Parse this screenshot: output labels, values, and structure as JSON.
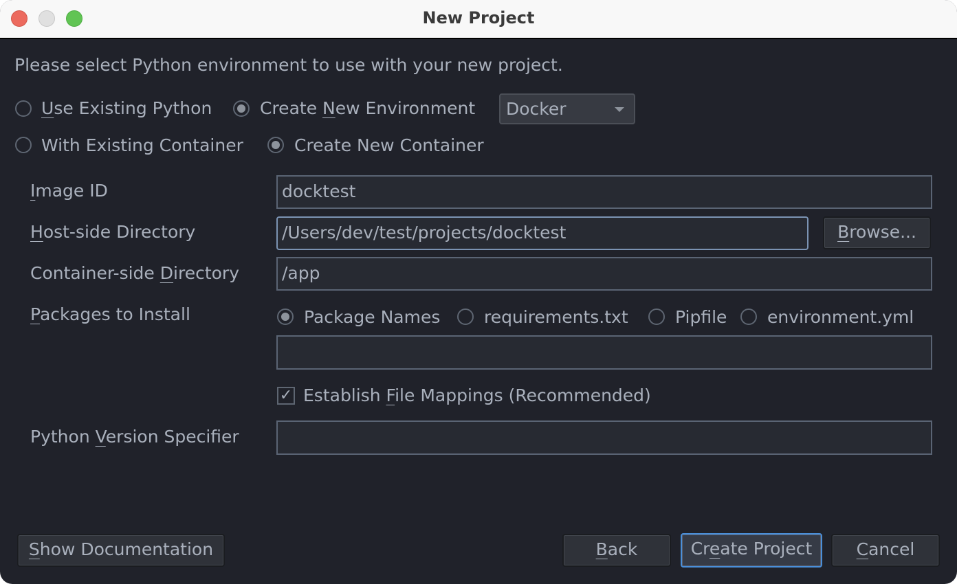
{
  "window": {
    "title": "New Project"
  },
  "intro": "Please select Python environment to use with your new project.",
  "env_options": [
    {
      "label_pre": "",
      "label_u": "U",
      "label_post": "se Existing Python",
      "selected": false
    },
    {
      "label_pre": "Create ",
      "label_u": "N",
      "label_post": "ew Environment",
      "selected": true
    }
  ],
  "env_type": {
    "selected": "Docker"
  },
  "container_options": [
    {
      "label": "With Existing Container",
      "selected": false
    },
    {
      "label": "Create New Container",
      "selected": true
    }
  ],
  "form": {
    "image_id": {
      "label_u": "I",
      "label_rest": "mage ID",
      "value": "docktest"
    },
    "host_dir": {
      "label_u": "H",
      "label_rest": "ost-side Directory",
      "value": "/Users/dev/test/projects/docktest",
      "browse": {
        "u": "B",
        "rest": "rowse..."
      }
    },
    "container_dir": {
      "label_pre": "Container-side ",
      "label_u": "D",
      "label_rest": "irectory",
      "value": "/app"
    },
    "packages": {
      "label_u": "P",
      "label_rest": "ackages to Install",
      "options": [
        {
          "label": "Package Names",
          "selected": true
        },
        {
          "label": "requirements.txt",
          "selected": false
        },
        {
          "label": "Pipfile",
          "selected": false
        },
        {
          "label": "environment.yml",
          "selected": false
        }
      ],
      "value": ""
    },
    "file_mappings": {
      "label_pre": "Establish ",
      "label_u": "F",
      "label_rest": "ile Mappings (Recommended)",
      "checked": true,
      "check_glyph": "✓"
    },
    "python_version": {
      "label_pre": "Python ",
      "label_u": "V",
      "label_rest": "ersion Specifier",
      "value": ""
    }
  },
  "buttons": {
    "show_docs": {
      "u": "S",
      "rest": "how Documentation"
    },
    "back": {
      "u": "B",
      "rest": "ack"
    },
    "create": {
      "pre": "Cr",
      "u": "e",
      "rest": "ate Project"
    },
    "cancel": {
      "u": "C",
      "rest": "ancel"
    }
  }
}
